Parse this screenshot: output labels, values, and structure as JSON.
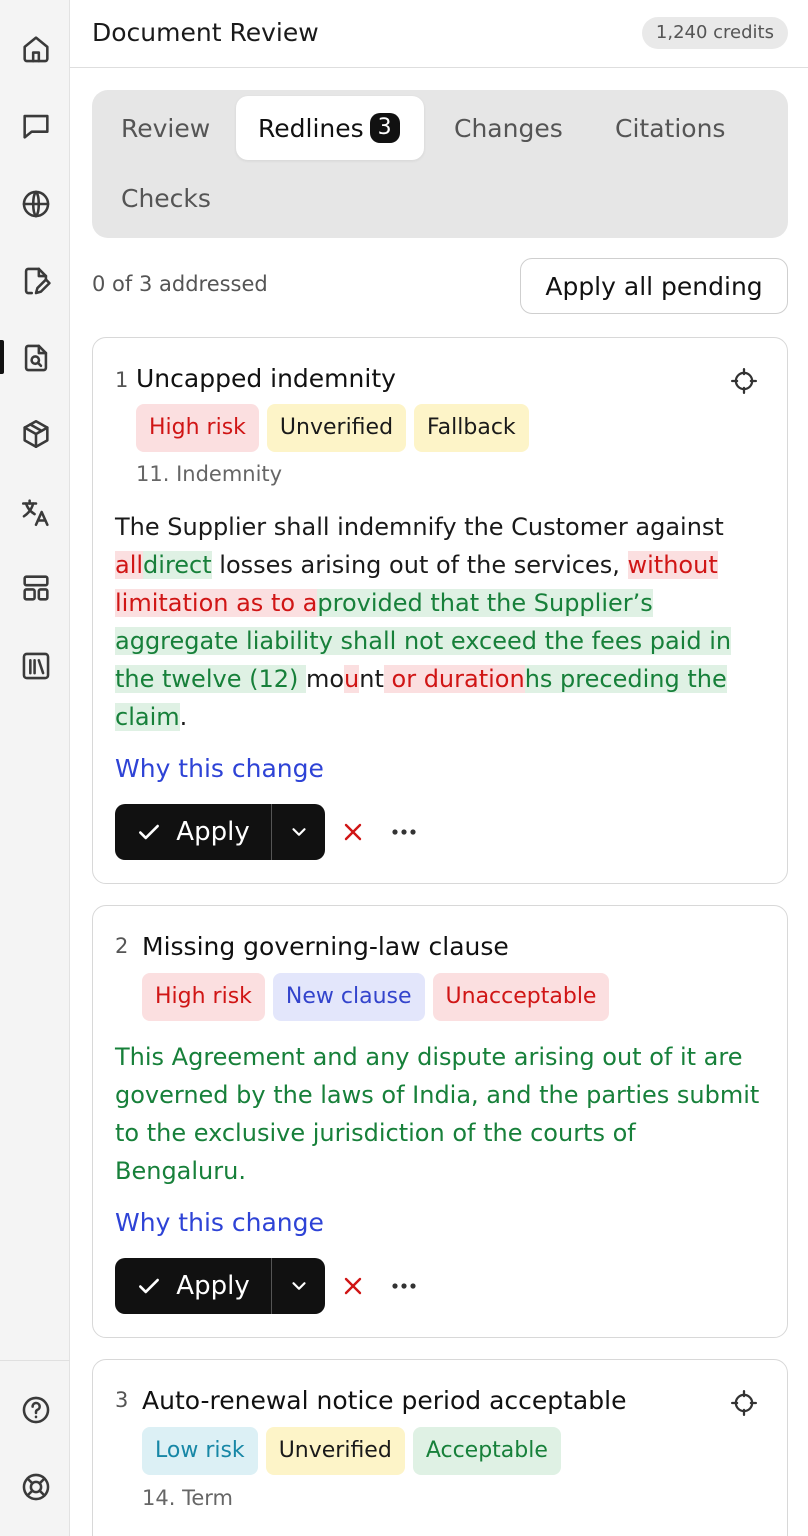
{
  "header": {
    "title": "Document Review",
    "credits": "1,240 credits"
  },
  "rail": {
    "icons": [
      "home-icon",
      "chat-icon",
      "globe-icon",
      "document-edit-icon",
      "document-search-icon",
      "cube-icon",
      "translate-icon",
      "layout-icon",
      "library-icon",
      "help-icon",
      "support-icon"
    ],
    "active": "document-search-icon"
  },
  "tabs": [
    {
      "label": "Review"
    },
    {
      "label": "Redlines",
      "badge": "3"
    },
    {
      "label": "Changes"
    },
    {
      "label": "Citations"
    },
    {
      "label": "Checks"
    }
  ],
  "active_tab": "Redlines",
  "progress": "0 of 3 addressed",
  "apply_all_label": "Apply all pending",
  "cards": [
    {
      "number": "1",
      "title": "Uncapped indemnity",
      "tags": [
        "High risk",
        "Unverified",
        "Fallback"
      ],
      "section": "11. Indemnity",
      "text": {
        "s1": "The Supplier shall indemnify the Customer against ",
        "d1": "all",
        "i1": "direct",
        "s2": " losses arising out of the services, ",
        "d2": "without limitation as to a",
        "i2": "provided that the Supplier’s aggregate liability shall not exceed the fees paid in the twelve (12) ",
        "s3": "mo",
        "d3": "u",
        "s4": "nt",
        "d4": " or duration",
        "i3": "hs preceding the claim",
        "s5": "."
      },
      "why": "Why this change",
      "apply": "Apply"
    },
    {
      "number": "2",
      "title": "Missing governing-law clause",
      "tags": [
        "High risk",
        "New clause",
        "Unacceptable"
      ],
      "text": "This Agreement and any dispute arising out of it are governed by the laws of India, and the parties submit to the exclusive jurisdiction of the courts of Bengaluru.",
      "why": "Why this change",
      "apply": "Apply"
    },
    {
      "number": "3",
      "title": "Auto-renewal notice period acceptable",
      "tags": [
        "Low risk",
        "Unverified",
        "Acceptable"
      ],
      "section": "14. Term"
    }
  ],
  "colors": {
    "accent_link": "#2e43d6",
    "risk_red": "#d01515",
    "insert_green": "#17803a",
    "primary_button": "#111111"
  }
}
